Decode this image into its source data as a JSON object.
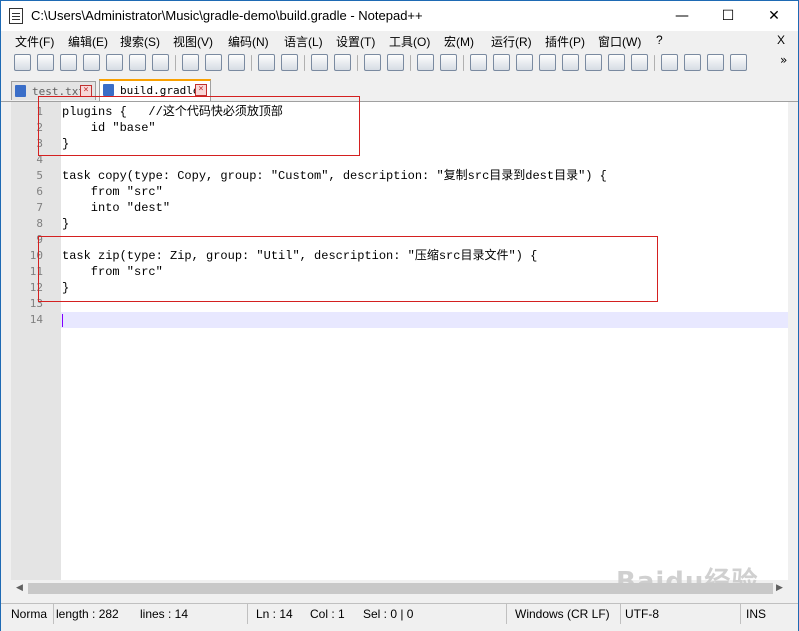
{
  "window": {
    "title": "C:\\Users\\Administrator\\Music\\gradle-demo\\build.gradle - Notepad++",
    "minimize": "—",
    "maximize": "☐",
    "close": "✕"
  },
  "menu": {
    "items": [
      "文件(F)",
      "编辑(E)",
      "搜索(S)",
      "视图(V)",
      "编码(N)",
      "语言(L)",
      "设置(T)",
      "工具(O)",
      "宏(M)",
      "运行(R)",
      "插件(P)",
      "窗口(W)",
      "?"
    ],
    "close": "X"
  },
  "toolbar": {
    "icons": [
      "new-file-icon",
      "open-file-icon",
      "save-icon",
      "save-all-icon",
      "close-icon",
      "close-all-icon",
      "print-icon",
      "cut-icon",
      "copy-icon",
      "paste-icon",
      "undo-icon",
      "redo-icon",
      "find-icon",
      "replace-icon",
      "zoom-in-icon",
      "zoom-out-icon",
      "sync-vertical-icon",
      "sync-horizontal-icon",
      "word-wrap-icon",
      "show-all-chars-icon",
      "indent-guide-icon",
      "doc-map-icon",
      "function-list-icon",
      "folder-workspace-icon",
      "monitor-icon",
      "record-macro-icon",
      "stop-record-icon",
      "play-macro-icon",
      "run-macro-multiple-icon",
      "save-macro-icon"
    ],
    "more": "»"
  },
  "tabs": [
    {
      "label": "test.txt",
      "active": false
    },
    {
      "label": "build.gradle",
      "active": true
    }
  ],
  "editor": {
    "lines": [
      "plugins {   //这个代码快必须放顶部",
      "    id \"base\"",
      "}",
      "",
      "task copy(type: Copy, group: \"Custom\", description: \"复制src目录到dest目录\") {",
      "    from \"src\"",
      "    into \"dest\"",
      "}",
      "",
      "task zip(type: Zip, group: \"Util\", description: \"压缩src目录文件\") {",
      "    from \"src\"",
      "}",
      "",
      ""
    ],
    "line_numbers": [
      "1",
      "2",
      "3",
      "4",
      "5",
      "6",
      "7",
      "8",
      "9",
      "10",
      "11",
      "12",
      "13",
      "14"
    ]
  },
  "scrollbar": {
    "left": "◀",
    "right": "▶"
  },
  "status": {
    "type": "Norma",
    "length": "length : 282",
    "lines": "lines : 14",
    "ln": "Ln : 14",
    "col": "Col : 1",
    "sel": "Sel : 0 | 0",
    "eol": "Windows (CR LF)",
    "encoding": "UTF-8",
    "mode": "INS"
  },
  "watermark": "Baidu经验",
  "colors": {
    "tab_accent": "#f9a000",
    "annotation": "#d42020",
    "caret": "#8000ff",
    "current_line": "#e8e8ff"
  }
}
